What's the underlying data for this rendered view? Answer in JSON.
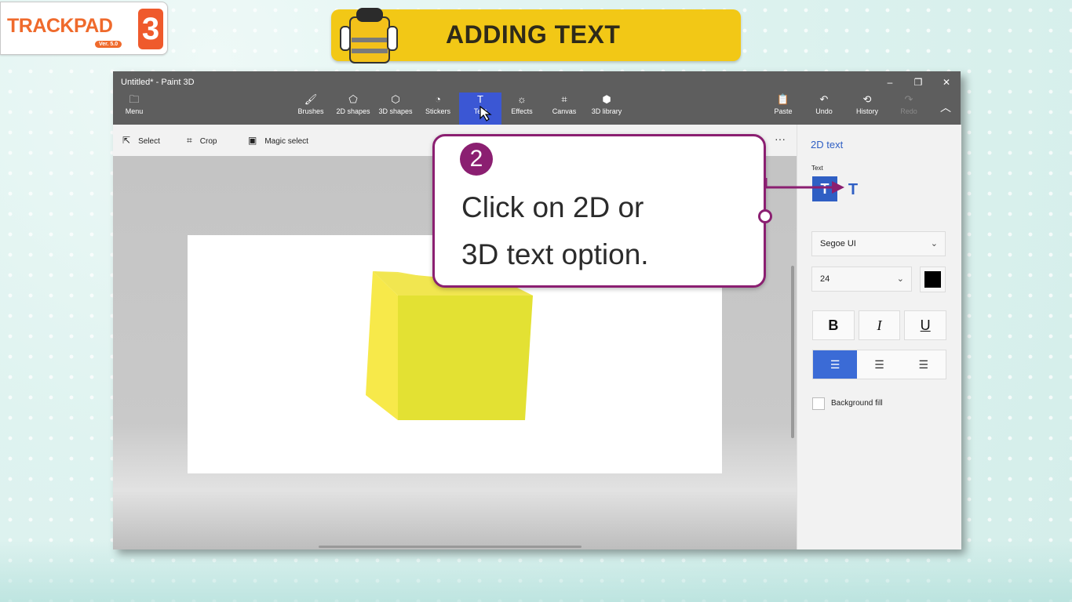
{
  "brand": {
    "name": "TRACKPAD",
    "version": "Ver. 5.0",
    "badge": "3"
  },
  "lesson": {
    "title": "ADDING TEXT"
  },
  "window": {
    "title": "Untitled* - Paint 3D",
    "controls": {
      "minimize": "–",
      "restore": "❐",
      "close": "✕"
    }
  },
  "toolbar": {
    "menu": {
      "label": "Menu",
      "icon": "folder-icon"
    },
    "tools": [
      {
        "label": "Brushes",
        "icon": "brush-icon"
      },
      {
        "label": "2D shapes",
        "icon": "2d-shapes-icon"
      },
      {
        "label": "3D shapes",
        "icon": "3d-shapes-icon"
      },
      {
        "label": "Stickers",
        "icon": "sticker-icon"
      },
      {
        "label": "Text",
        "icon": "text-icon",
        "active": true
      },
      {
        "label": "Effects",
        "icon": "effects-icon"
      },
      {
        "label": "Canvas",
        "icon": "canvas-icon"
      },
      {
        "label": "3D library",
        "icon": "3d-library-icon"
      }
    ],
    "right": [
      {
        "label": "Paste",
        "icon": "paste-icon"
      },
      {
        "label": "Undo",
        "icon": "undo-icon"
      },
      {
        "label": "History",
        "icon": "history-icon"
      },
      {
        "label": "Redo",
        "icon": "redo-icon",
        "disabled": true
      }
    ]
  },
  "subbar": {
    "select": "Select",
    "crop": "Crop",
    "magic_select": "Magic select",
    "more": "···"
  },
  "panel": {
    "title": "2D text",
    "text_label": "Text",
    "font": "Segoe UI",
    "size": "24",
    "color": "#000000",
    "bold": "B",
    "italic": "I",
    "underline": "U",
    "background_fill": "Background fill",
    "accent": "#2f5fc4"
  },
  "callout": {
    "step": "2",
    "line1": "Click on 2D or",
    "line2": "3D text option.",
    "color": "#8b1f71"
  }
}
